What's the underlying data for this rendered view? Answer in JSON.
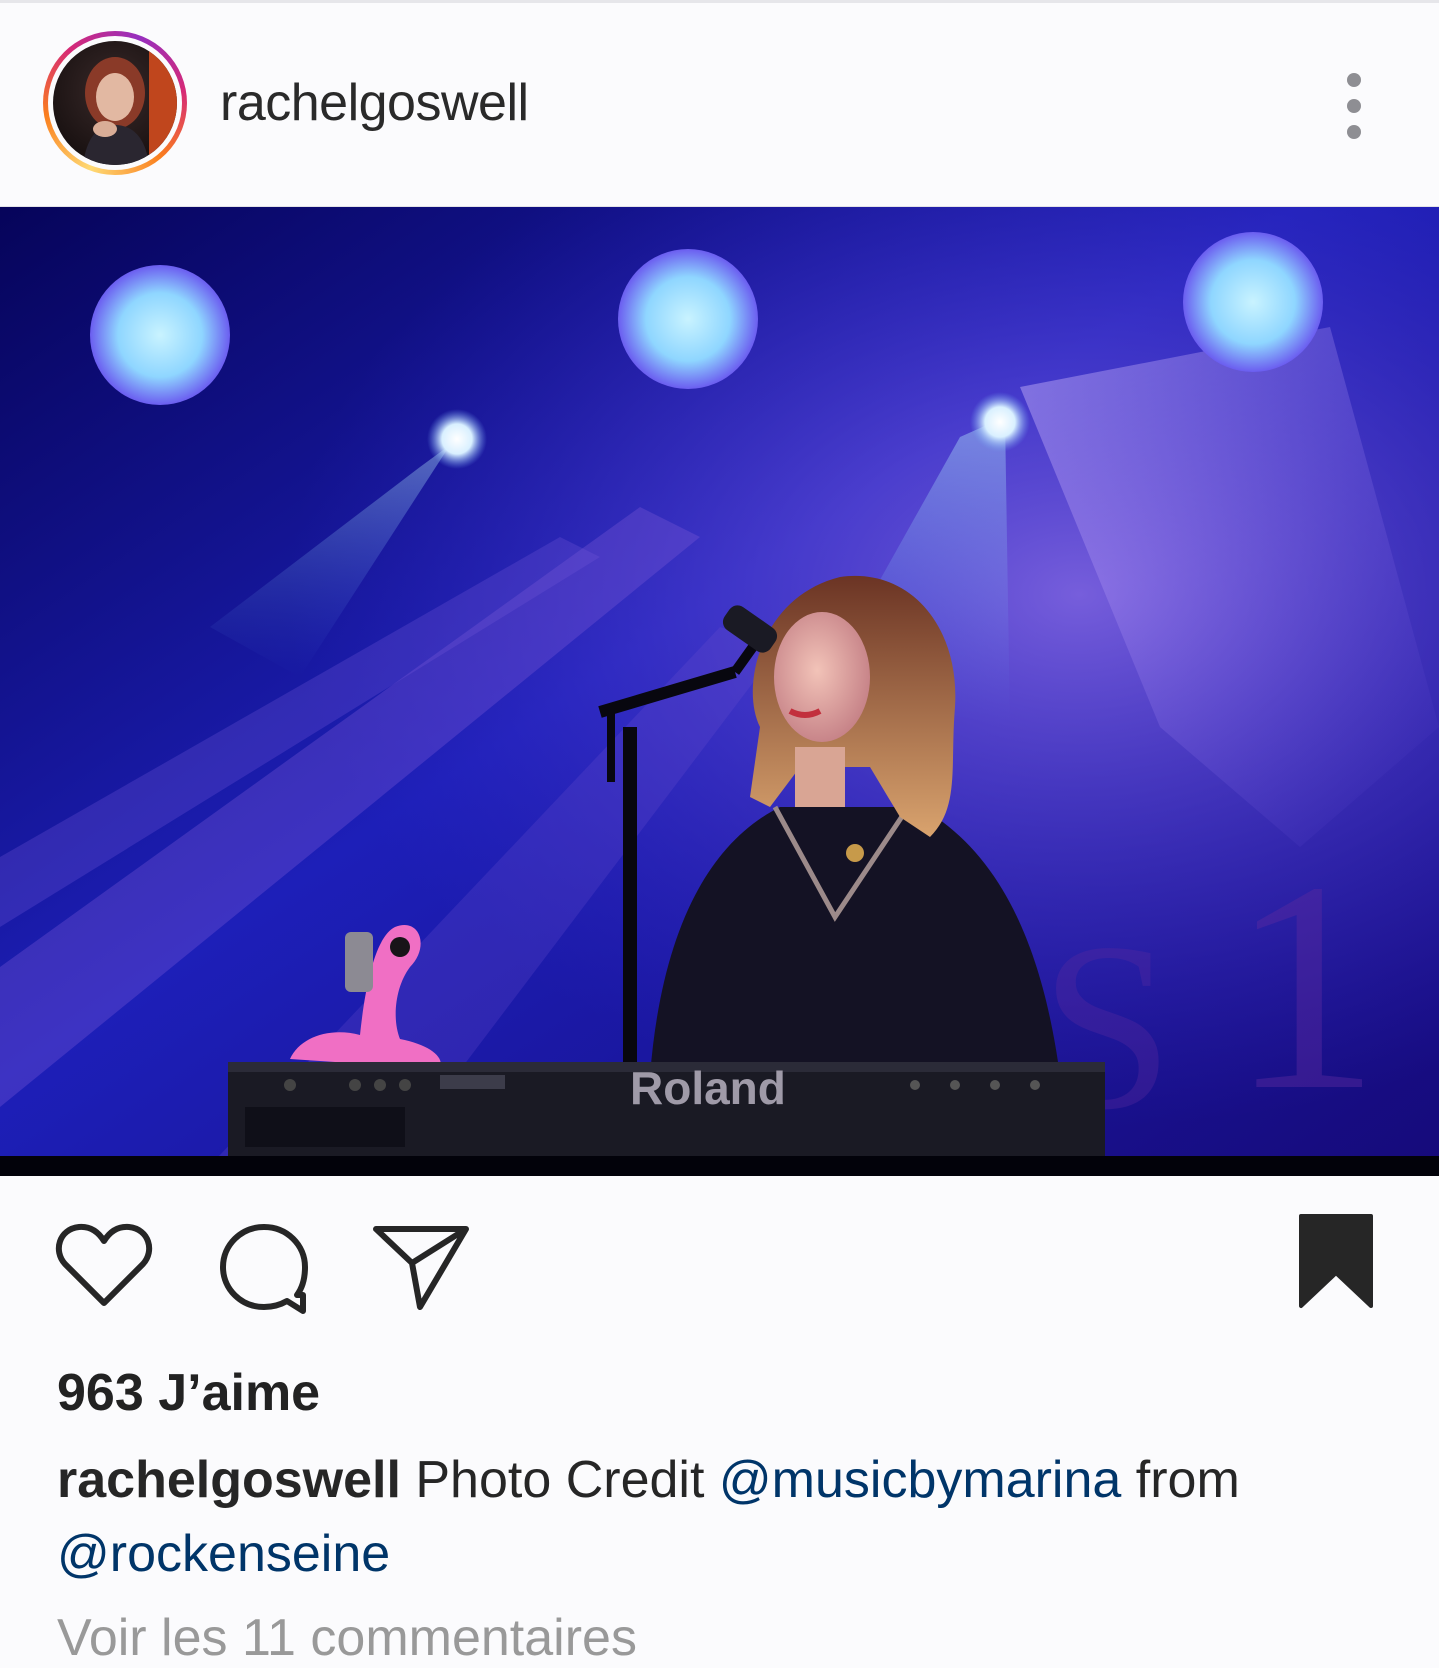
{
  "post": {
    "username": "rachelgoswell",
    "likes_text": "963 J’aime",
    "caption": {
      "username": "rachelgoswell",
      "text_before": "Photo Credit",
      "mention_1": "@musicbymarina",
      "text_between": "from",
      "mention_2": "@rockenseine"
    },
    "view_comments": "Voir les 11 commentaires",
    "keyboard_brand": "Roland"
  },
  "icons": {
    "like": "heart-icon",
    "comment": "comment-bubble-icon",
    "share": "paper-plane-icon",
    "save": "bookmark-filled-icon",
    "more": "more-vertical-icon"
  },
  "colors": {
    "mention": "#003569",
    "text": "#262626",
    "muted": "#999999"
  }
}
